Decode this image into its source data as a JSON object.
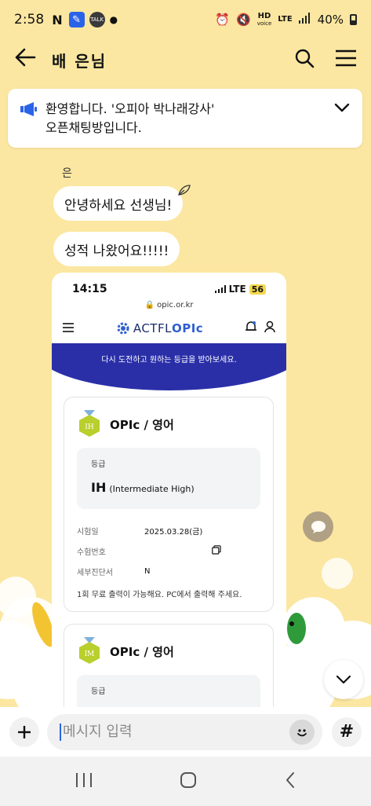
{
  "status_bar": {
    "time": "2:58",
    "app_letter": "N",
    "talk_badge": "TALK",
    "hd_label": "HD",
    "voice_label": "voice",
    "lte_label": "LTE",
    "battery": "40%"
  },
  "header": {
    "title": "배  은님"
  },
  "notice": {
    "line1": "환영합니다. '오피아 박나래강사'",
    "line2": "오픈채팅방입니다."
  },
  "chat": {
    "sender_name": "은",
    "messages": [
      {
        "text": "안녕하세요 선생님!"
      },
      {
        "text": "성적 나왔어요!!!!!"
      }
    ]
  },
  "shared_image": {
    "time": "14:15",
    "network": "LTE",
    "battery_level": "56",
    "url": "opic.or.kr",
    "brand_prefix": "ACTFL",
    "brand_suffix": "OPIc",
    "banner_text": "다시 도전하고 원하는 등급을 받아보세요.",
    "card1": {
      "title": "OPIc / 영어",
      "medal": "IH",
      "grade_label": "등급",
      "grade_code": "IH",
      "grade_name": "(Intermediate High)",
      "rows": [
        {
          "label": "시험일",
          "value": "2025.03.28(금)"
        },
        {
          "label": "수험번호",
          "value": ""
        },
        {
          "label": "세부진단서",
          "value": "N"
        }
      ],
      "note": "1회 무료 출력이 가능해요. PC에서 출력해 주세요."
    },
    "card2": {
      "title": "OPIc / 영어",
      "medal": "IM",
      "grade_label": "등급"
    }
  },
  "input": {
    "placeholder": "메시지 입력"
  },
  "colors": {
    "chat_bg": "#FBE7A1",
    "accent_blue": "#2B63E8",
    "banner_navy": "#2A2FA8"
  }
}
